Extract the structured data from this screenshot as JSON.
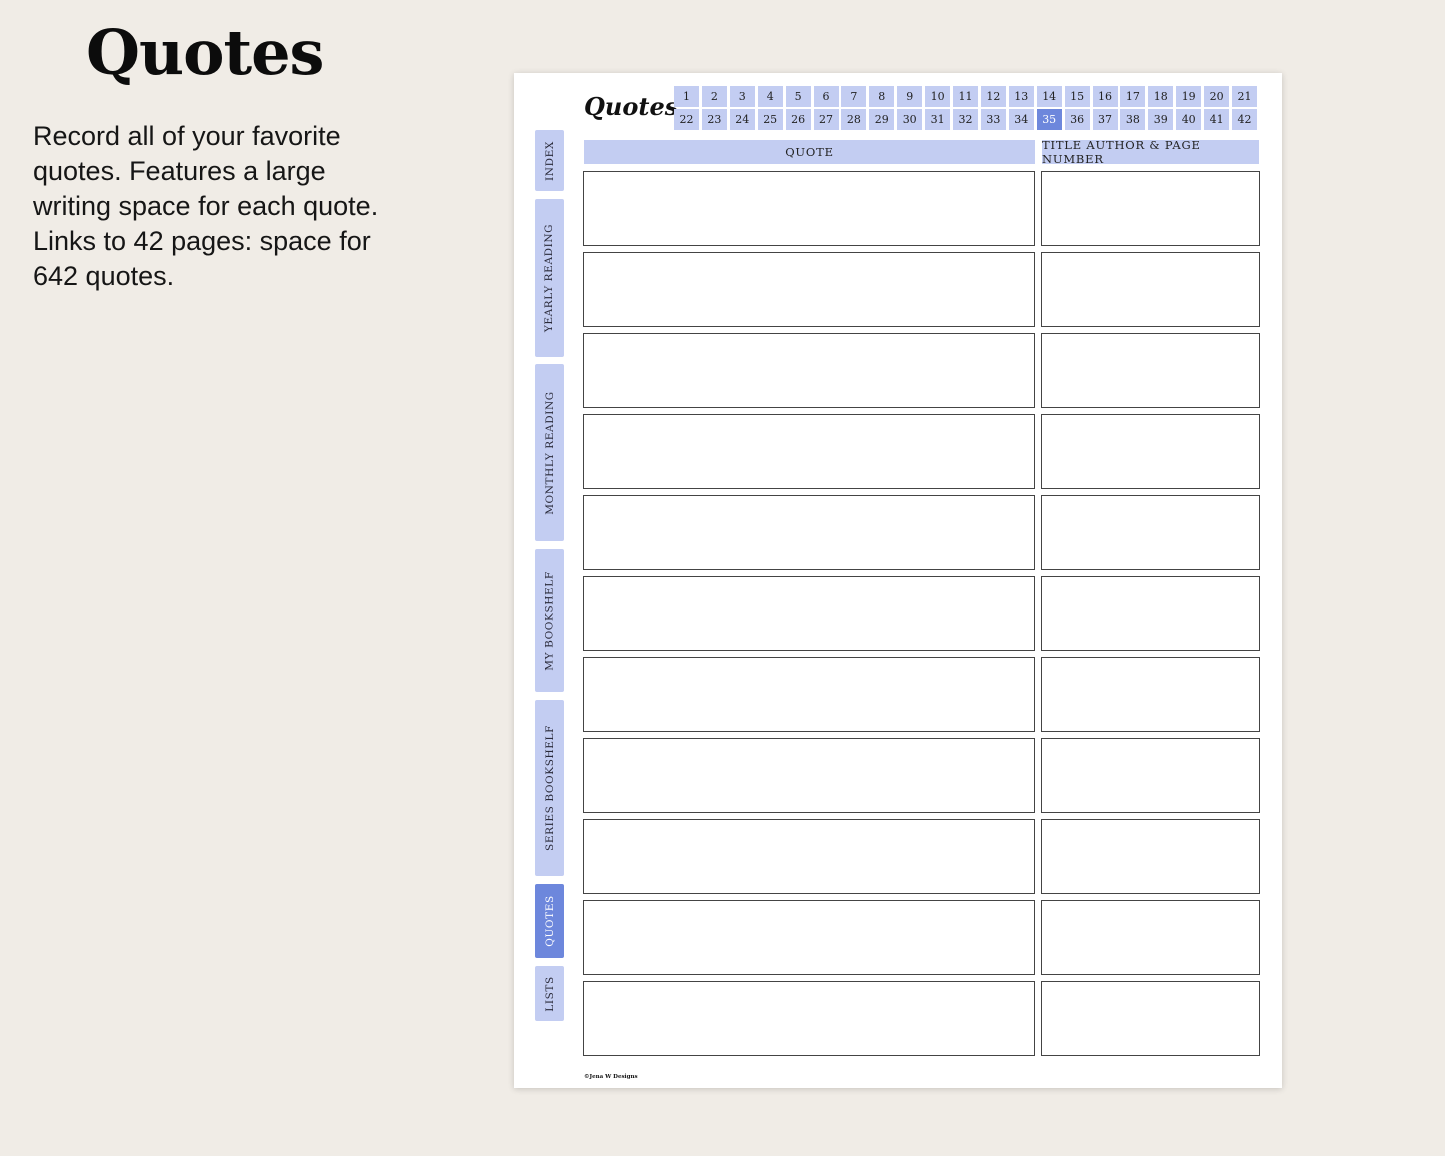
{
  "promo": {
    "title": "Quotes",
    "description_lines": [
      "Record all of your favorite quotes. Features a large writing space for each quote.",
      "Links to 42 pages: space for 642 quotes."
    ]
  },
  "planner": {
    "title": "Quotes",
    "side_tabs": [
      {
        "label": "INDEX",
        "active": false
      },
      {
        "label": "YEARLY READING",
        "active": false
      },
      {
        "label": "MONTHLY READING",
        "active": false
      },
      {
        "label": "MY BOOKSHELF",
        "active": false
      },
      {
        "label": "SERIES BOOKSHELF",
        "active": false
      },
      {
        "label": "QUOTES",
        "active": true
      },
      {
        "label": "LISTS",
        "active": false
      }
    ],
    "page_links": [
      "1",
      "2",
      "3",
      "4",
      "5",
      "6",
      "7",
      "8",
      "9",
      "10",
      "11",
      "12",
      "13",
      "14",
      "15",
      "16",
      "17",
      "18",
      "19",
      "20",
      "21",
      "22",
      "23",
      "24",
      "25",
      "26",
      "27",
      "28",
      "29",
      "30",
      "31",
      "32",
      "33",
      "34",
      "35",
      "36",
      "37",
      "38",
      "39",
      "40",
      "41",
      "42"
    ],
    "current_page": "35",
    "columns": {
      "quote": "QUOTE",
      "source": "TITLE AUTHOR & PAGE NUMBER"
    },
    "entries": [
      {
        "quote": "",
        "source": ""
      },
      {
        "quote": "",
        "source": ""
      },
      {
        "quote": "",
        "source": ""
      },
      {
        "quote": "",
        "source": ""
      },
      {
        "quote": "",
        "source": ""
      },
      {
        "quote": "",
        "source": ""
      },
      {
        "quote": "",
        "source": ""
      },
      {
        "quote": "",
        "source": ""
      },
      {
        "quote": "",
        "source": ""
      },
      {
        "quote": "",
        "source": ""
      },
      {
        "quote": "",
        "source": ""
      }
    ],
    "footer": "©Jena W Designs"
  },
  "colors": {
    "background": "#f0ece6",
    "tab_fill": "#c3cdf2",
    "tab_active": "#6d87dc"
  }
}
